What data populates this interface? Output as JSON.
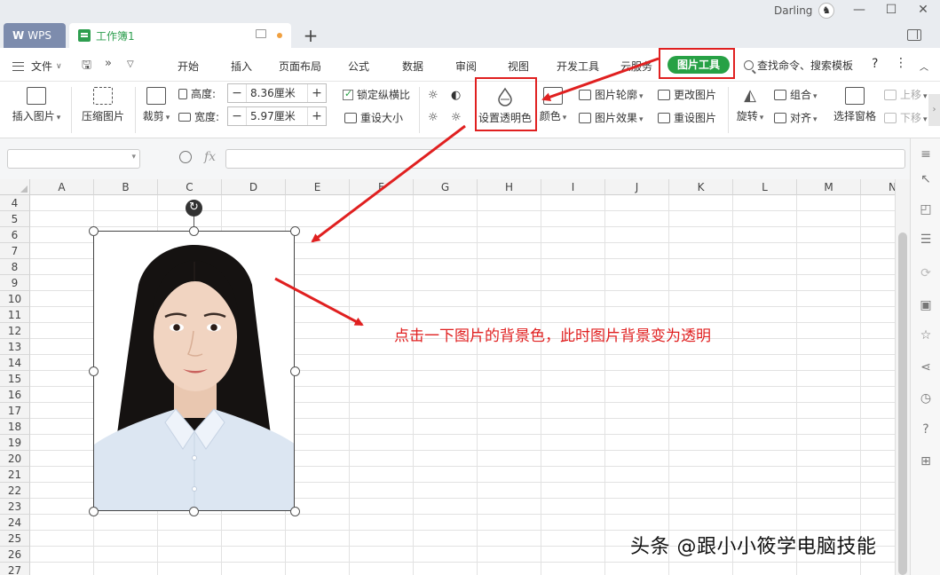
{
  "titlebar": {
    "app_tab": "WPS",
    "doc_tab": "工作簿1",
    "add_tab": "+",
    "user_name": "Darling",
    "window_controls": [
      "minimize-icon",
      "maximize-icon",
      "close-icon"
    ]
  },
  "menubar": {
    "file_label": "文件",
    "tabs": [
      "开始",
      "插入",
      "页面布局",
      "公式",
      "数据",
      "审阅",
      "视图",
      "开发工具",
      "云服务"
    ],
    "active_tab": "图片工具",
    "search_label": "查找命令、搜索模板",
    "help": "?"
  },
  "ribbon": {
    "insert_picture": "插入图片",
    "compress_picture": "压缩图片",
    "crop": "裁剪",
    "height_label": "高度:",
    "height_value": "8.36厘米",
    "width_label": "宽度:",
    "width_value": "5.97厘米",
    "lock_ratio": "锁定纵横比",
    "reset_size": "重设大小",
    "set_transparent": "设置透明色",
    "color": "颜色",
    "picture_outline": "图片轮廓",
    "picture_effects": "图片效果",
    "change_picture": "更改图片",
    "reset_picture": "重设图片",
    "rotate": "旋转",
    "group": "组合",
    "align": "对齐",
    "selection_pane": "选择窗格",
    "bring_forward": "上移",
    "send_backward": "下移"
  },
  "formula": {
    "fx": "fx"
  },
  "grid": {
    "columns": [
      "A",
      "B",
      "C",
      "D",
      "E",
      "F",
      "G",
      "H",
      "I",
      "J",
      "K",
      "L",
      "M",
      "N"
    ],
    "rows": [
      "4",
      "5",
      "6",
      "7",
      "8",
      "9",
      "10",
      "11",
      "12",
      "13",
      "14",
      "15",
      "16",
      "17",
      "18",
      "19",
      "20",
      "21",
      "22",
      "23",
      "24",
      "25",
      "26",
      "27"
    ]
  },
  "annotation": "点击一下图片的背景色，此时图片背景变为透明",
  "watermark": "头条 @跟小小筱学电脑技能",
  "colors": {
    "accent_green": "#27a145",
    "highlight_red": "#e02020"
  }
}
